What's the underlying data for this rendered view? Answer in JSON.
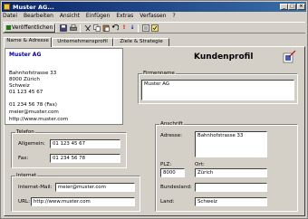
{
  "window": {
    "title": "Muster AG..."
  },
  "menu": [
    "Datei",
    "Bearbeiten",
    "Ansicht",
    "Einfügen",
    "Extras",
    "Verfassen",
    "?"
  ],
  "toolbar": {
    "publish_label": "Veröffentlichen"
  },
  "tabs": [
    "Name & Adresse",
    "Unternehmensprofil",
    "Ziele & Strategie"
  ],
  "card": {
    "company": "Muster AG",
    "street": "Bahnhofstrasse 33",
    "city": "8000  Zürich",
    "country": "Schweiz",
    "phone": "01 123 45 67",
    "fax": "01 234 56 78 (Fax)",
    "email": "meier@muster.com",
    "web": "http://www.muster.com"
  },
  "heading": "Kundenprofil",
  "firmenname": {
    "legend": "Firmenname",
    "value": "Muster AG"
  },
  "telefon": {
    "legend": "Telefon",
    "allgemein_label": "Allgemein:",
    "allgemein_value": "01 123 45 67",
    "fax_label": "Fax:",
    "fax_value": "01 234 56 78"
  },
  "internet": {
    "legend": "Internet",
    "email_label": "Internet-Mail:",
    "email_value": "meier@muster.com",
    "url_label": "URL:",
    "url_value": "http://www.muster.com"
  },
  "anschrift": {
    "legend": "Anschrift",
    "adresse_label": "Adresse:",
    "adresse_value": "Bahnhofstrasse 33",
    "plz_label": "PLZ:",
    "plz_value": "8000",
    "ort_label": "Ort:",
    "ort_value": "Zürich",
    "bundesland_label": "Bundesland:",
    "bundesland_value": "",
    "land_label": "Land:",
    "land_value": "Schweiz"
  }
}
